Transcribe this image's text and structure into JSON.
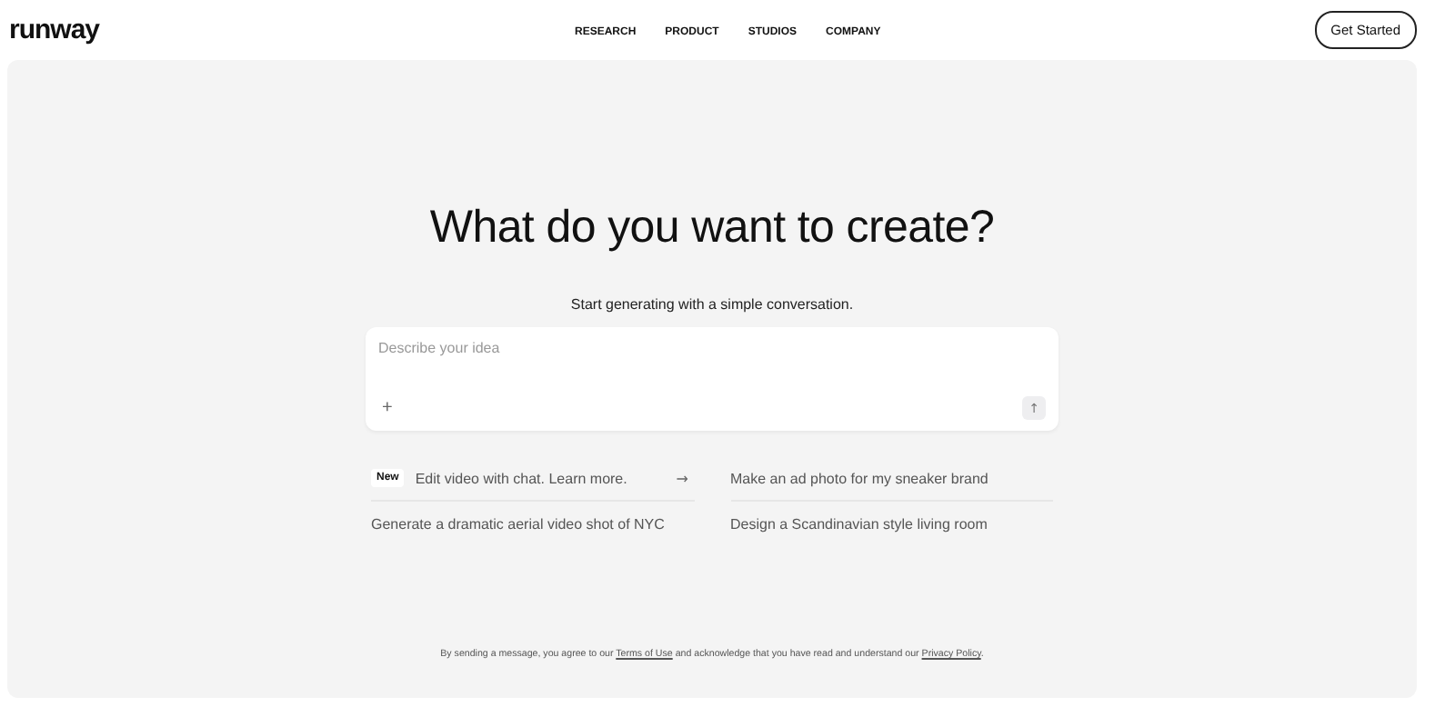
{
  "header": {
    "logo": "runway",
    "nav": [
      "RESEARCH",
      "PRODUCT",
      "STUDIOS",
      "COMPANY"
    ],
    "cta": "Get Started"
  },
  "hero": {
    "title": "What do you want to create?",
    "subtitle": "Start generating with a simple conversation."
  },
  "prompt": {
    "placeholder": "Describe your idea",
    "add": "+",
    "send": "↑"
  },
  "suggestions": [
    {
      "badge": "New",
      "text": "Edit video with chat. Learn more.",
      "arrow": "→"
    },
    {
      "text": "Make an ad photo for my sneaker brand"
    },
    {
      "text": "Generate a dramatic aerial video shot of NYC"
    },
    {
      "text": "Design a Scandinavian style living room"
    }
  ],
  "footer": [
    {
      "kind": "text",
      "text": "By sending a message, you agree to our "
    },
    {
      "kind": "link",
      "text": "Terms of Use"
    },
    {
      "kind": "text",
      "text": " and acknowledge that you have read and understand our "
    },
    {
      "kind": "link",
      "text": "Privacy Policy"
    },
    {
      "kind": "text",
      "text": "."
    }
  ]
}
